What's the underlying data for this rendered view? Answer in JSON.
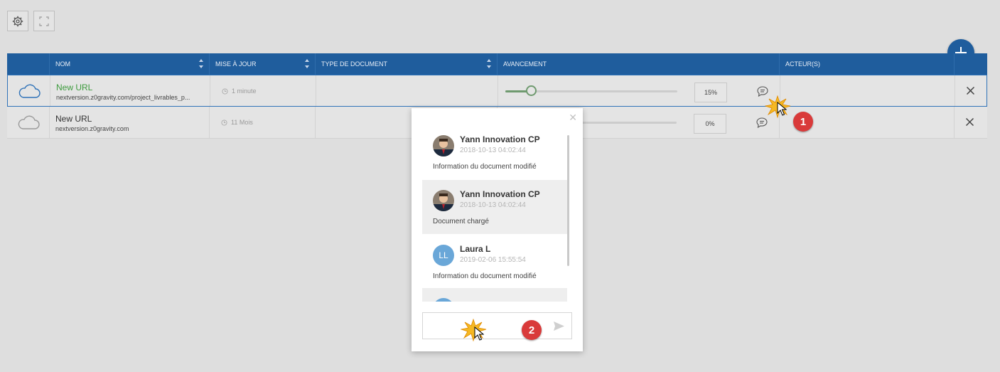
{
  "toolbar": {
    "settings_icon": "gear-icon",
    "fullscreen_icon": "expand-icon"
  },
  "table": {
    "columns": [
      "Nom",
      "Mise à jour",
      "Type de document",
      "Avancement",
      "Acteur(s)"
    ],
    "rows": [
      {
        "name": "New URL",
        "url": "nextversion.z0gravity.com/project_livrables_p...",
        "updated": "1 minute",
        "type": "",
        "progress_value": 15,
        "progress": "15%",
        "actors": "",
        "name_color": "#3c9a3c",
        "selected": true
      },
      {
        "name": "New URL",
        "url": "nextversion.z0gravity.com",
        "updated": "11 Mois",
        "type": "",
        "progress_value": 0,
        "progress": "0%",
        "actors": "",
        "name_color": "#333333",
        "selected": false
      }
    ]
  },
  "annotations": {
    "badge1": "1",
    "badge2": "2"
  },
  "comments": {
    "entries": [
      {
        "author": "Yann Innovation CP",
        "date": "2018-10-13 04:02:44",
        "message": "Information du document modifié",
        "avatar": "photo"
      },
      {
        "author": "Yann Innovation CP",
        "date": "2018-10-13 04:02:44",
        "message": "Document chargé",
        "avatar": "photo"
      },
      {
        "author": "Laura L",
        "date": "2019-02-06 15:55:54",
        "message": "Information du document modifié",
        "avatar": "LL"
      },
      {
        "author": "",
        "date": "",
        "message": "",
        "avatar": ""
      }
    ],
    "input_placeholder": ""
  },
  "colors": {
    "header": "#1f5d9d",
    "accent_green": "#3c9a3c",
    "badge_red": "#d93a3a",
    "avatar_blue": "#6aa7d8"
  }
}
